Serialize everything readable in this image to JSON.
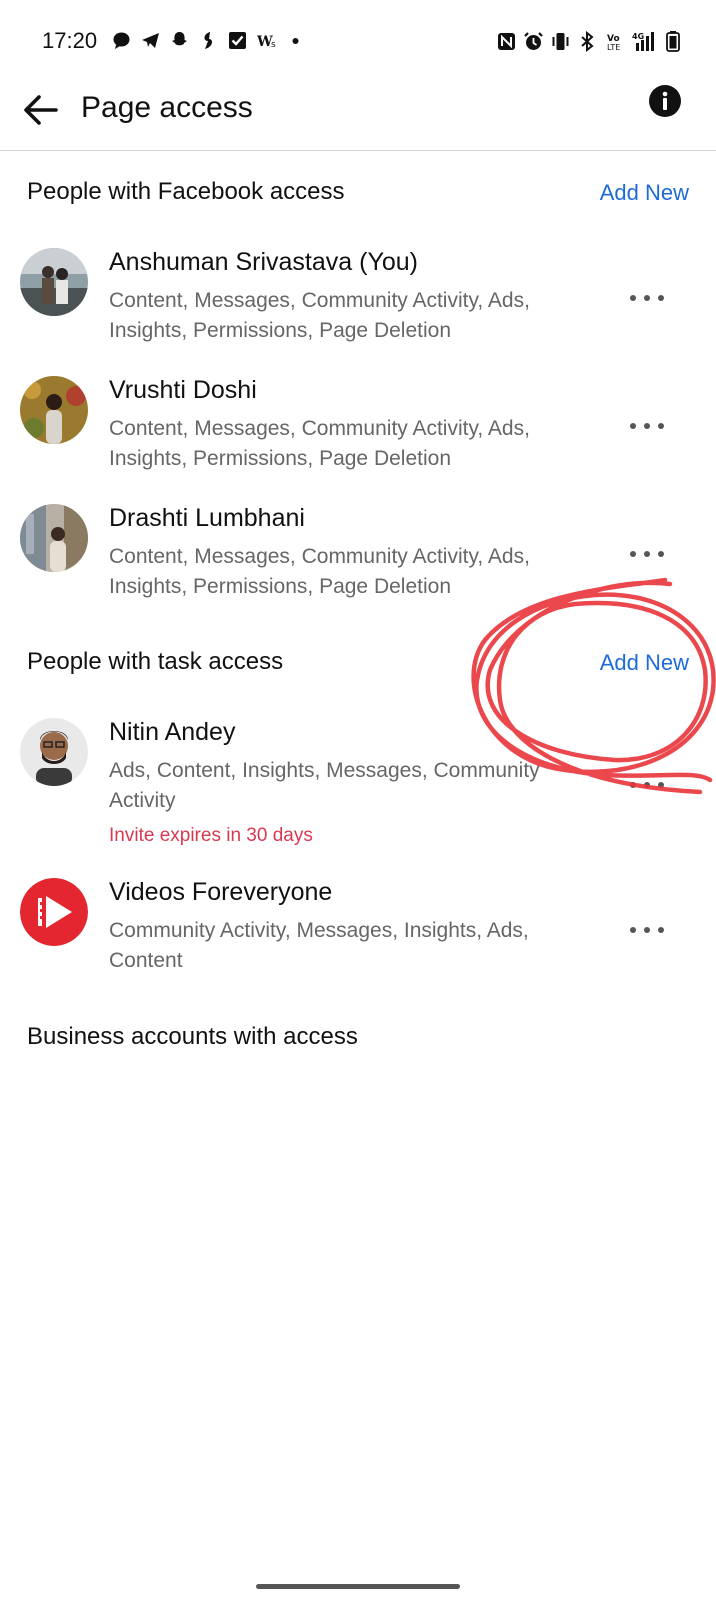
{
  "status_bar": {
    "time": "17:20",
    "notification_icons": [
      "chat-bubble-icon",
      "telegram-icon",
      "snapchat-icon",
      "alt-icon",
      "checkbox-icon",
      "ws-icon",
      "dot-icon"
    ],
    "system_icons": [
      "nfc-icon",
      "alarm-icon",
      "vibrate-icon",
      "bluetooth-icon",
      "volte-icon",
      "4g-signal-icon",
      "battery-icon"
    ]
  },
  "app_bar": {
    "title": "Page access"
  },
  "sections": {
    "facebook_access": {
      "label": "People with Facebook access",
      "add_label": "Add New",
      "people": [
        {
          "name": "Anshuman Srivastava (You)",
          "permissions": "Content, Messages, Community Activity, Ads, Insights, Permissions, Page Deletion"
        },
        {
          "name": "Vrushti Doshi",
          "permissions": "Content, Messages, Community Activity, Ads, Insights, Permissions, Page Deletion"
        },
        {
          "name": "Drashti Lumbhani",
          "permissions": "Content, Messages, Community Activity, Ads, Insights, Permissions, Page Deletion"
        }
      ]
    },
    "task_access": {
      "label": "People with task access",
      "add_label": "Add New",
      "people": [
        {
          "name": "Nitin Andey",
          "permissions": "Ads, Content, Insights, Messages, Community Activity",
          "invite": "Invite expires in 30 days"
        },
        {
          "name": "Videos Foreveryone",
          "permissions": "Community Activity, Messages, Insights, Ads, Content"
        }
      ]
    },
    "business_access": {
      "label": "Business accounts with access"
    }
  },
  "colors": {
    "link_blue": "#1f6bd6",
    "invite_red": "#d73a50",
    "annotation_red": "#e8343a"
  }
}
